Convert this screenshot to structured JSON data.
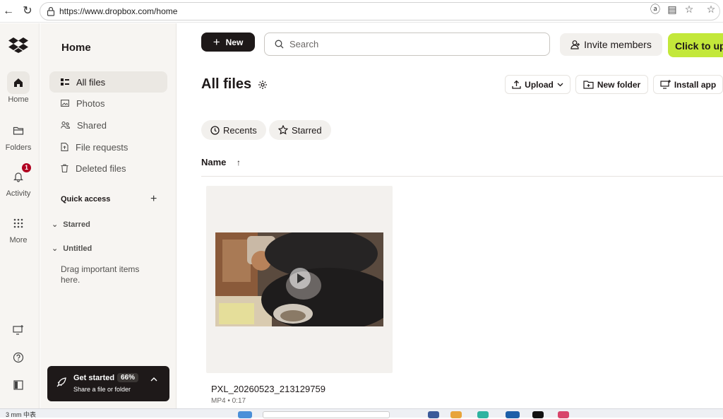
{
  "browser": {
    "url": "https://www.dropbox.com/home"
  },
  "rail": {
    "items": [
      {
        "label": "Home"
      },
      {
        "label": "Folders"
      },
      {
        "label": "Activity",
        "badge": "1"
      },
      {
        "label": "More"
      }
    ]
  },
  "panel": {
    "title": "Home",
    "nav": [
      {
        "label": "All files"
      },
      {
        "label": "Photos"
      },
      {
        "label": "Shared"
      },
      {
        "label": "File requests"
      },
      {
        "label": "Deleted files"
      }
    ],
    "quick_access": {
      "heading": "Quick access",
      "add": "+",
      "starred": "Starred",
      "untitled": "Untitled",
      "note": "Drag important items here."
    },
    "get_started": {
      "title": "Get started",
      "percent": "66%",
      "subtitle": "Share a file or folder"
    }
  },
  "toolbar": {
    "new_label": "New",
    "search_placeholder": "Search",
    "invite_label": "Invite members",
    "upgrade_label": "Click to up"
  },
  "main": {
    "title": "All files",
    "actions": {
      "upload": "Upload",
      "new_folder": "New folder",
      "install_app": "Install app"
    },
    "chips": {
      "recents": "Recents",
      "starred": "Starred"
    },
    "column_name": "Name",
    "sort_indicator": "↑",
    "files": [
      {
        "name": "PXL_20260523_213129759",
        "meta": "MP4 • 0:17"
      }
    ]
  },
  "taskbar": {
    "text": "3 mm 中表"
  },
  "colors": {
    "accent_dark": "#1e1919",
    "upgrade_green": "#c3e83a",
    "sidebar_bg": "#f7f5f2",
    "badge_red": "#b00020"
  }
}
